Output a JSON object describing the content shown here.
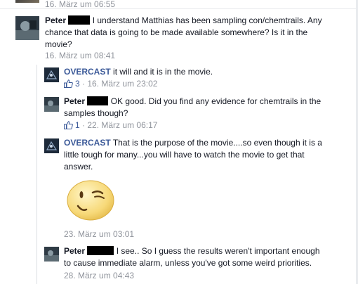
{
  "top_comment": {
    "timestamp": "16. März um 06:55"
  },
  "comment_peter_1": {
    "author": "Peter",
    "text_line1": "I understand Matthias has been sampling con/chemtrails. Any",
    "text_line2": "chance that data is going to be made available somewhere? Is it in the",
    "text_line3": "movie?",
    "timestamp": "16. März um 08:41"
  },
  "reply_overcast_1": {
    "author": "OVERCAST",
    "text": "it will and it is in the movie.",
    "likes": "3",
    "separator": "·",
    "timestamp": "16. März um 23:02"
  },
  "reply_peter_2": {
    "author": "Peter",
    "text_line1": "OK good. Did you find any evidence for chemtrails in the",
    "text_line2": "samples though?",
    "likes": "1",
    "separator": "·",
    "timestamp": "22. März um 06:17"
  },
  "reply_overcast_2": {
    "author": "OVERCAST",
    "text_line1": "That is the purpose of the movie....so even though it is a",
    "text_line2": "little tough for many...you will have to watch the movie to get that",
    "text_line3": "answer.",
    "sticker": "wink-smiley-sticker",
    "timestamp": "23. März um 03:01"
  },
  "reply_peter_3": {
    "author": "Peter",
    "text_line1": "I see.. So I guess the results weren't important enough",
    "text_line2": "to cause immediate alarm, unless you've got some weird priorities.",
    "timestamp": "28. März um 04:43"
  },
  "colors": {
    "link": "#3b5998",
    "timestamp": "#90949c",
    "text": "#141823",
    "redaction": "#000000"
  }
}
